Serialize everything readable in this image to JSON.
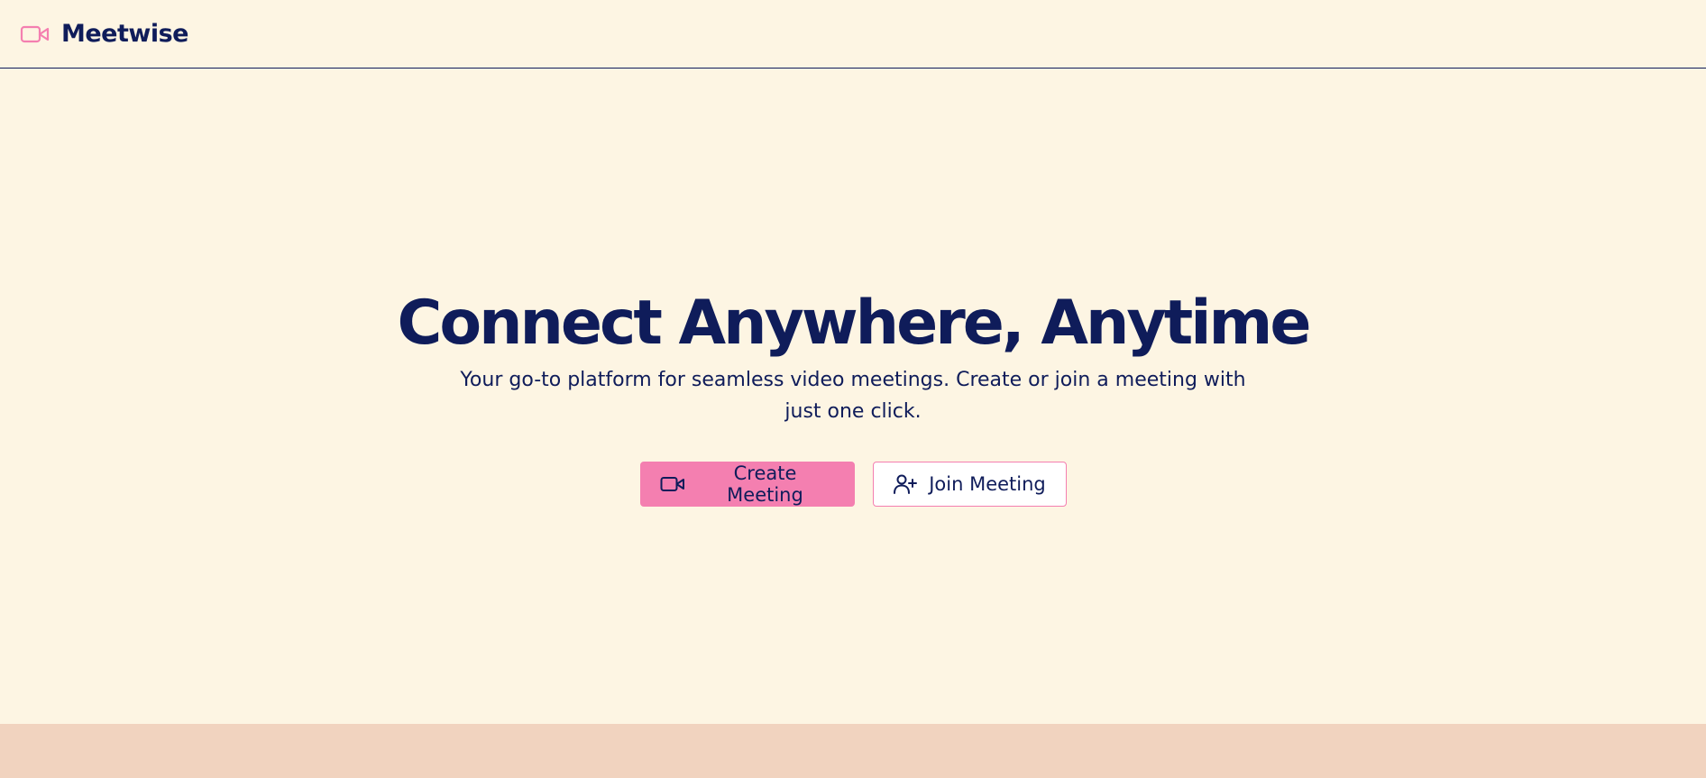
{
  "header": {
    "brand_icon": "video-camera-icon",
    "brand_name": "Meetwise"
  },
  "hero": {
    "title": "Connect Anywhere, Anytime",
    "subtitle": "Your go-to platform for seamless video meetings. Create or join a meeting with just one click."
  },
  "actions": {
    "create_label": "Create Meeting",
    "create_icon": "video-camera-icon",
    "join_label": "Join Meeting",
    "join_icon": "user-plus-icon"
  },
  "colors": {
    "background": "#fdf5e3",
    "accent": "#f47fb0",
    "text": "#0f1c5a",
    "footer": "#f1d3bf"
  }
}
